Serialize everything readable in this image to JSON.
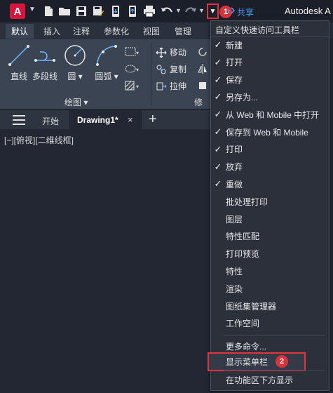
{
  "titlebar": {
    "logo_letter": "A",
    "share_label": "共享",
    "app_name": "Autodesk A"
  },
  "badges": {
    "one": "1",
    "two": "2"
  },
  "ribbon": {
    "tabs": [
      "默认",
      "插入",
      "注释",
      "参数化",
      "视图",
      "管理"
    ],
    "tools": {
      "line": "直线",
      "polyline": "多段线",
      "circle": "圆",
      "arc": "圆弧",
      "move": "移动",
      "copy": "复制",
      "stretch": "拉伸"
    },
    "groups": {
      "draw": "绘图 ▾",
      "modify": "修改"
    }
  },
  "doctabs": {
    "start": "开始",
    "active": "Drawing1*",
    "close": "×",
    "plus": "+"
  },
  "viewport": {
    "label": "[−][俯视][二维线框]"
  },
  "menu": {
    "header": "自定义快速访问工具栏",
    "items": [
      {
        "label": "新建",
        "checked": true
      },
      {
        "label": "打开",
        "checked": true
      },
      {
        "label": "保存",
        "checked": true
      },
      {
        "label": "另存为...",
        "checked": true
      },
      {
        "label": "从 Web 和 Mobile 中打开",
        "checked": true
      },
      {
        "label": "保存到 Web 和 Mobile",
        "checked": true
      },
      {
        "label": "打印",
        "checked": true
      },
      {
        "label": "放弃",
        "checked": true
      },
      {
        "label": "重做",
        "checked": true
      },
      {
        "label": "批处理打印",
        "checked": false
      },
      {
        "label": "图层",
        "checked": false
      },
      {
        "label": "特性匹配",
        "checked": false
      },
      {
        "label": "打印预览",
        "checked": false
      },
      {
        "label": "特性",
        "checked": false
      },
      {
        "label": "渲染",
        "checked": false
      },
      {
        "label": "图纸集管理器",
        "checked": false
      },
      {
        "label": "工作空间",
        "checked": false
      }
    ],
    "more_commands": "更多命令...",
    "show_menubar": "显示菜单栏",
    "show_below_ribbon": "在功能区下方显示",
    "check_glyph": "✓"
  },
  "colors": {
    "accent_red": "#e2343b",
    "logo_red": "#d6163c",
    "share_blue": "#4aa3ff",
    "menu_bg": "#2b303b"
  }
}
